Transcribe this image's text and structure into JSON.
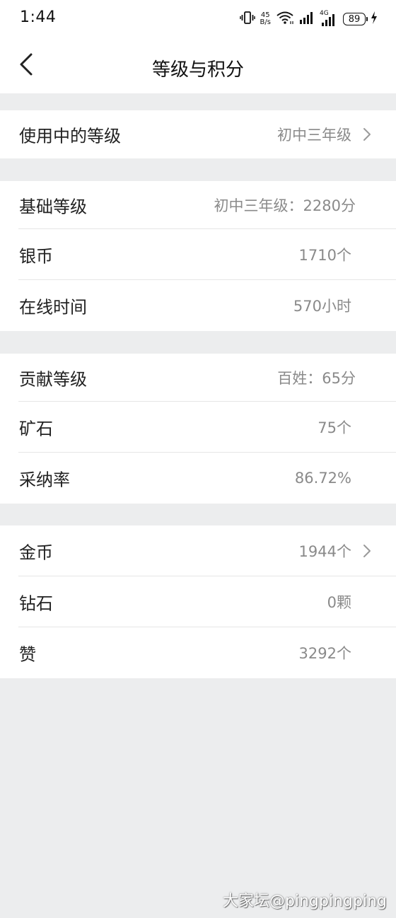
{
  "status_bar": {
    "time": "1:44",
    "net_speed_value": "45",
    "net_speed_unit": "B/s",
    "network_type": "4G",
    "battery": "89",
    "icons": [
      "vibrate-icon",
      "wifi-icon",
      "signal-icon",
      "signal-4g-icon",
      "battery-icon",
      "charging-icon"
    ]
  },
  "header": {
    "title": "等级与积分",
    "back_icon": "back-arrow-icon"
  },
  "sections": {
    "current": {
      "items": [
        {
          "label": "使用中的等级",
          "value": "初中三年级"
        }
      ]
    },
    "basic": {
      "items": [
        {
          "label": "基础等级",
          "value": "初中三年级：2280分"
        },
        {
          "label": "银币",
          "value": "1710个"
        },
        {
          "label": "在线时间",
          "value": "570小时"
        }
      ]
    },
    "contribution": {
      "items": [
        {
          "label": "贡献等级",
          "value": "百姓：65分"
        },
        {
          "label": "矿石",
          "value": "75个"
        },
        {
          "label": "采纳率",
          "value": "86.72%"
        }
      ]
    },
    "assets": {
      "items": [
        {
          "label": "金币",
          "value": "1944个"
        },
        {
          "label": "钻石",
          "value": "0颗"
        },
        {
          "label": "赞",
          "value": "3292个"
        }
      ]
    }
  },
  "watermark": "大家坛@pingpingping",
  "colors": {
    "background": "#ecedee",
    "card": "#ffffff",
    "label_text": "#222222",
    "value_text": "#8a8a8a",
    "divider": "#e6e6e6"
  }
}
